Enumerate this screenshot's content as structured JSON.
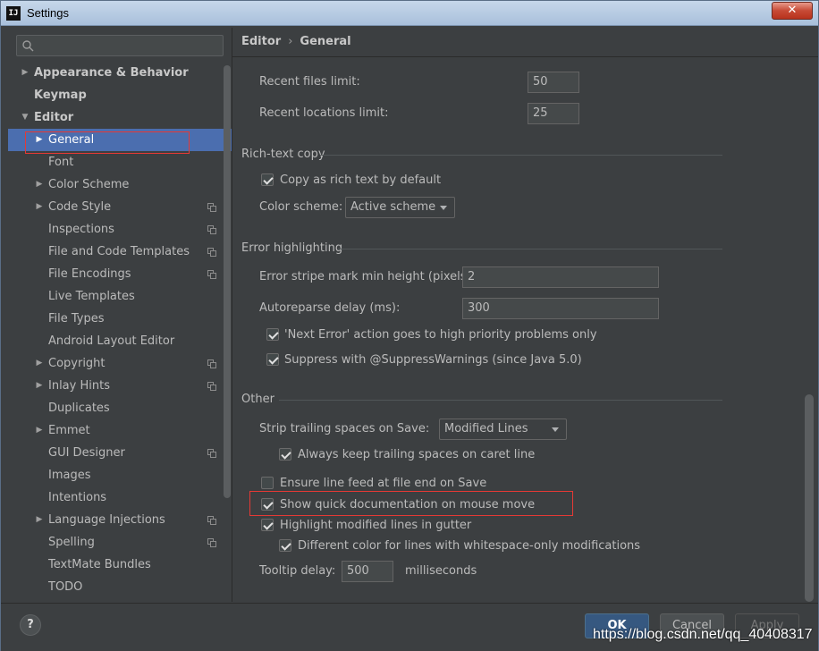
{
  "window": {
    "title": "Settings",
    "app_icon_text": "IJ",
    "close_glyph": "✕"
  },
  "sidebar": {
    "search_placeholder": "",
    "items": [
      {
        "label": "Appearance & Behavior",
        "arrow": "▶",
        "bold": true
      },
      {
        "label": "Keymap",
        "arrow": "",
        "bold": true
      },
      {
        "label": "Editor",
        "arrow": "▼",
        "bold": true
      },
      {
        "label": "General",
        "arrow": "▶",
        "selected": true
      },
      {
        "label": "Font",
        "arrow": ""
      },
      {
        "label": "Color Scheme",
        "arrow": "▶"
      },
      {
        "label": "Code Style",
        "arrow": "▶",
        "copy_icon": true
      },
      {
        "label": "Inspections",
        "arrow": "",
        "copy_icon": true
      },
      {
        "label": "File and Code Templates",
        "arrow": "",
        "copy_icon": true
      },
      {
        "label": "File Encodings",
        "arrow": "",
        "copy_icon": true
      },
      {
        "label": "Live Templates",
        "arrow": ""
      },
      {
        "label": "File Types",
        "arrow": ""
      },
      {
        "label": "Android Layout Editor",
        "arrow": ""
      },
      {
        "label": "Copyright",
        "arrow": "▶",
        "copy_icon": true
      },
      {
        "label": "Inlay Hints",
        "arrow": "▶",
        "copy_icon": true
      },
      {
        "label": "Duplicates",
        "arrow": ""
      },
      {
        "label": "Emmet",
        "arrow": "▶"
      },
      {
        "label": "GUI Designer",
        "arrow": "",
        "copy_icon": true
      },
      {
        "label": "Images",
        "arrow": ""
      },
      {
        "label": "Intentions",
        "arrow": ""
      },
      {
        "label": "Language Injections",
        "arrow": "▶",
        "copy_icon": true
      },
      {
        "label": "Spelling",
        "arrow": "",
        "copy_icon": true
      },
      {
        "label": "TextMate Bundles",
        "arrow": ""
      },
      {
        "label": "TODO",
        "arrow": ""
      }
    ]
  },
  "breadcrumb": {
    "parent": "Editor",
    "separator": "›",
    "current": "General"
  },
  "main": {
    "recent_files_label": "Recent files limit:",
    "recent_files_value": "50",
    "recent_locations_label": "Recent locations limit:",
    "recent_locations_value": "25",
    "rich_text": {
      "title": "Rich-text copy",
      "copy_rich_label": "Copy as rich text by default",
      "copy_rich_checked": true,
      "color_scheme_label": "Color scheme:",
      "color_scheme_value": "Active scheme"
    },
    "error_highlighting": {
      "title": "Error highlighting",
      "stripe_label": "Error stripe mark min height (pixels):",
      "stripe_value": "2",
      "autoreparse_label": "Autoreparse delay (ms):",
      "autoreparse_value": "300",
      "next_error_label": "'Next Error' action goes to high priority problems only",
      "next_error_checked": true,
      "suppress_label": "Suppress with @SuppressWarnings (since Java 5.0)",
      "suppress_checked": true
    },
    "other": {
      "title": "Other",
      "strip_label": "Strip trailing spaces on Save:",
      "strip_value": "Modified Lines",
      "keep_trailing_label": "Always keep trailing spaces on caret line",
      "keep_trailing_checked": true,
      "ensure_lf_label": "Ensure line feed at file end on Save",
      "ensure_lf_checked": false,
      "quick_doc_label": "Show quick documentation on mouse move",
      "quick_doc_checked": true,
      "highlight_modified_label": "Highlight modified lines in gutter",
      "highlight_modified_checked": true,
      "different_color_label": "Different color for lines with whitespace-only modifications",
      "different_color_checked": true,
      "tooltip_label": "Tooltip delay:",
      "tooltip_value": "500",
      "tooltip_unit": "milliseconds"
    }
  },
  "footer": {
    "help_label": "?",
    "ok_label": "OK",
    "cancel_label": "Cancel",
    "apply_label": "Apply",
    "watermark": "https://blog.csdn.net/qq_40408317"
  },
  "colors": {
    "background": "#3c3f41",
    "selection": "#4b6eaf",
    "primary_button": "#365880",
    "annotation_red": "#e53935"
  }
}
